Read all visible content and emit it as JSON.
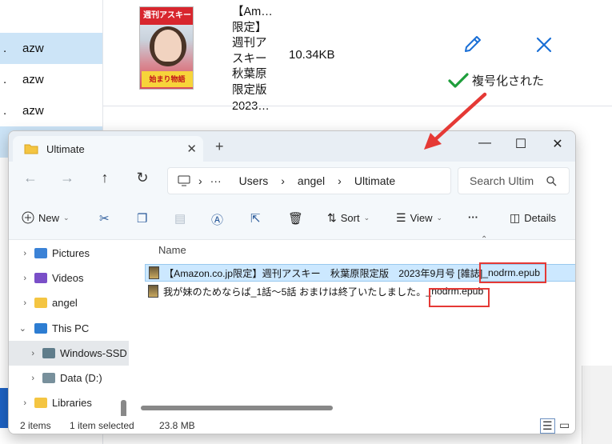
{
  "background_app": {
    "rows": [
      {
        "dot": "",
        "label": "",
        "selected": false
      },
      {
        "dot": ".",
        "label": "azw",
        "selected": true
      },
      {
        "dot": ".",
        "label": "azw",
        "selected": false
      },
      {
        "dot": ".",
        "label": "azw",
        "selected": false
      },
      {
        "dot": "",
        "label": "",
        "selected": true
      }
    ],
    "book": {
      "cover_masthead": "週刊アスキー",
      "cover_band": "始まり物語",
      "title_lines": "【Am…\n限定】\n週刊ア\nスキー\n秋葉原\n限定版\n2023…",
      "size": "10.34KB",
      "status": "複号化された",
      "edit_icon": "pencil-icon",
      "delete_icon": "close-icon"
    }
  },
  "window": {
    "tab_title": "Ultimate",
    "tab_close": "✕",
    "new_tab": "+",
    "controls": {
      "minimize": "—",
      "maximize": "☐",
      "close": "✕"
    },
    "nav": {
      "back": "←",
      "forward": "→",
      "up": "↑",
      "refresh": "↻"
    },
    "breadcrumb": {
      "ellipsis": "···",
      "items": [
        "Users",
        "angel",
        "Ultimate"
      ],
      "sep": "›"
    },
    "search_placeholder": "Search Ultim",
    "toolbar": {
      "new": "New",
      "sort": "Sort",
      "view": "View",
      "more": "···",
      "details": "Details"
    },
    "sidebar": [
      {
        "label": "Pictures",
        "icon": "pictures-icon",
        "selected": false
      },
      {
        "label": "Videos",
        "icon": "videos-icon",
        "selected": false
      },
      {
        "label": "angel",
        "icon": "folder-icon",
        "selected": false
      },
      {
        "label": "This PC",
        "icon": "pc-icon",
        "selected": false
      },
      {
        "label": "Windows-SSD",
        "icon": "drive-icon",
        "selected": true
      },
      {
        "label": "Data (D:)",
        "icon": "drive-icon",
        "selected": false
      },
      {
        "label": "Libraries",
        "icon": "folder-icon",
        "selected": false
      }
    ],
    "column_header": "Name",
    "files": [
      {
        "name_main": "【Amazon.co.jp限定】週刊アスキー　秋葉原限定版　2023年9月号 [雑誌]",
        "name_suffix": "_nodrm.epub",
        "selected": true
      },
      {
        "name_main": "我が妹のためならば_1話～5話 おまけは終了いたしました。",
        "name_suffix": "_nodrm.epub",
        "selected": false
      }
    ],
    "status": {
      "count": "2 items",
      "selected": "1 item selected",
      "size": "23.8 MB"
    }
  },
  "colors": {
    "accent": "#0067c0",
    "highlight_box": "#e53935",
    "check": "#1e9e3b",
    "arrow": "#e53935"
  }
}
